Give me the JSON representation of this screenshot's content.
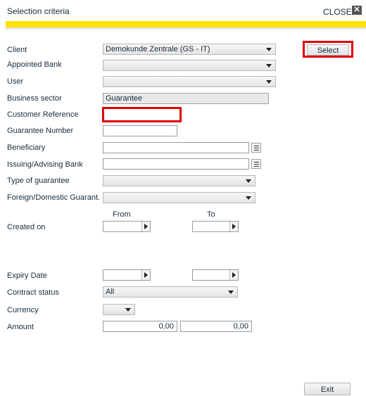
{
  "header": {
    "title": "Selection criteria",
    "close_label": "CLOSE",
    "close_icon": "close-icon"
  },
  "colors": {
    "accent_bar": "#ffe500",
    "highlight": "#e00000"
  },
  "form": {
    "client_label": "Client",
    "client_value": "Demokunde Zentrale (GS - IT)",
    "appointed_bank_label": "Appointed Bank",
    "user_label": "User",
    "business_sector_label": "Business sector",
    "business_sector_value": "Guarantee",
    "customer_reference_label": "Customer Reference",
    "guarantee_number_label": "Guarantee Number",
    "beneficiary_label": "Beneficiary",
    "issuing_bank_label": "Issuing/Advising Bank",
    "type_of_guarantee_label": "Type of guarantee",
    "foreign_domestic_label": "Foreign/Domestic Guarant.",
    "from_label": "From",
    "to_label": "To",
    "created_on_label": "Created on",
    "expiry_date_label": "Expiry Date",
    "contract_status_label": "Contract status",
    "contract_status_value": "All",
    "currency_label": "Currency",
    "amount_label": "Amount",
    "amount_from": "0,00",
    "amount_to": "0,00"
  },
  "buttons": {
    "select_label": "Select",
    "exit_label": "Exit"
  }
}
